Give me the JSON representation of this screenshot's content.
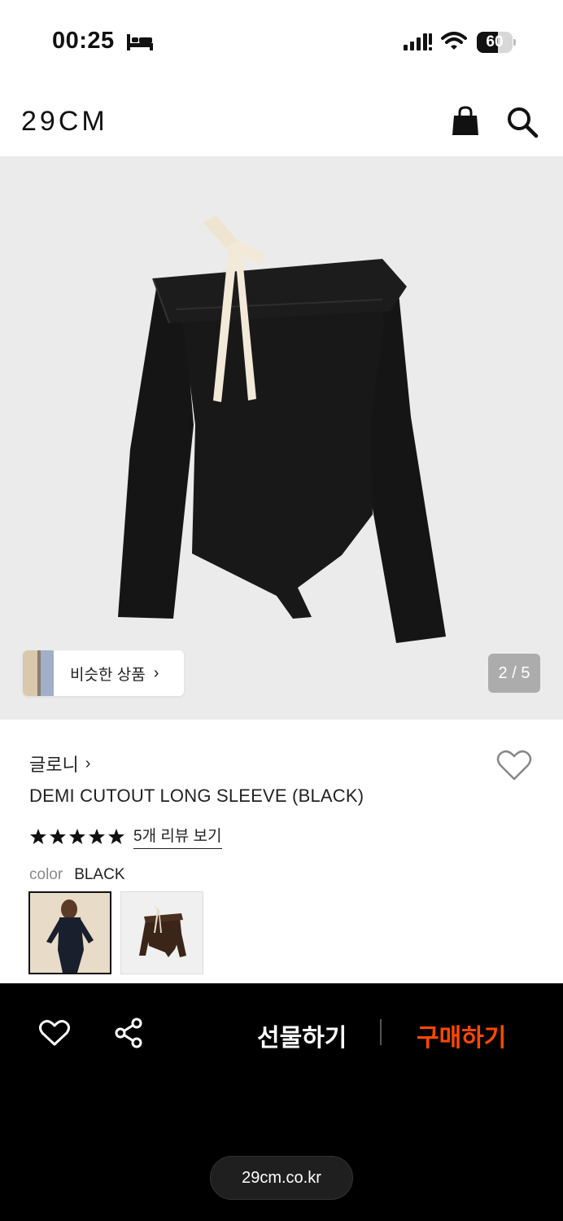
{
  "status_bar": {
    "time": "00:25",
    "sleep_icon": "bed-icon",
    "signal_icon": "cellular-signal-icon",
    "wifi_icon": "wifi-icon",
    "battery_level": "60",
    "battery_fraction": 0.6
  },
  "header": {
    "logo": "29CM",
    "bag_icon": "shopping-bag-icon",
    "search_icon": "search-icon"
  },
  "gallery": {
    "similar_label": "비슷한 상품",
    "similar_chevron": "›",
    "counter": "2 / 5",
    "background_color": "#ebebeb"
  },
  "product": {
    "brand": "글로니",
    "brand_chevron": "›",
    "name": "DEMI CUTOUT LONG SLEEVE (BLACK)",
    "rating_stars": 5,
    "review_link": "5개 리뷰 보기",
    "color_label": "color",
    "color_value": "BLACK",
    "wish_icon": "heart-outline-icon"
  },
  "bottom_bar": {
    "heart_icon": "heart-outline-icon",
    "share_icon": "share-icon",
    "gift_label": "선물하기",
    "buy_label": "구매하기",
    "buy_color": "#ff4800",
    "url": "29cm.co.kr"
  }
}
